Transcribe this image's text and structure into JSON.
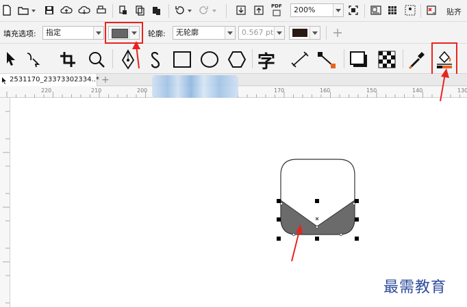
{
  "standard_toolbar": {
    "zoom_value": "200%",
    "pdf_label": "PDF",
    "snap_label": "贴齐"
  },
  "property_bar": {
    "fill_label": "填充选项:",
    "fill_value": "指定",
    "outline_label": "轮廓:",
    "outline_value": "无轮廓",
    "outline_width": "0.567 pt",
    "fill_swatch_color": "#666666",
    "outline_swatch_color": "#2a1a14"
  },
  "toolbox": {
    "text_tool_glyph": "字"
  },
  "document_tab": {
    "title": "2531170_23373302334..*",
    "add_glyph": "+"
  },
  "ruler": {
    "h_labels": [
      "220",
      "210",
      "200",
      "170",
      "160",
      "150",
      "140",
      "130"
    ]
  },
  "shape": {
    "fill_color": "#6b6b6b",
    "outline_color": "#333333"
  },
  "watermark": {
    "text": "最需教育"
  },
  "accent": {
    "highlight": "#e8231f"
  }
}
